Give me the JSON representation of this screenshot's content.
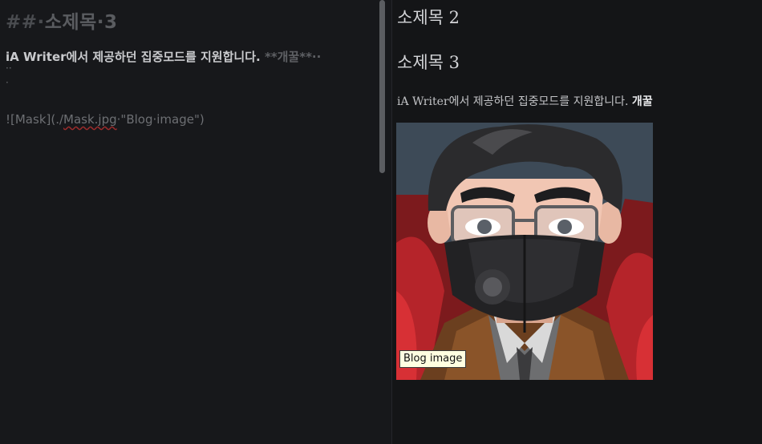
{
  "editor": {
    "heading": {
      "marker": "##·",
      "text": "소제목·3"
    },
    "body": {
      "text": "iA Writer에서 제공하던 집중모드를 지원합니다. ",
      "dimmed": "**개꿀**··"
    },
    "dot_line_1": "··",
    "dot_line_2": "·",
    "image_line": {
      "prefix": "![Mask](./",
      "file": "Mask.jpg",
      "suffix": "·\"Blog·image\")"
    }
  },
  "preview": {
    "heading_2": "소제목 2",
    "heading_3": "소제목 3",
    "paragraph": {
      "text": "iA Writer에서 제공하던 집중모드를 지원합니다. ",
      "bold": "개꿀"
    },
    "image": {
      "alt": "Mask",
      "title": "Blog image"
    }
  },
  "tooltip": {
    "text": "Blog image"
  }
}
